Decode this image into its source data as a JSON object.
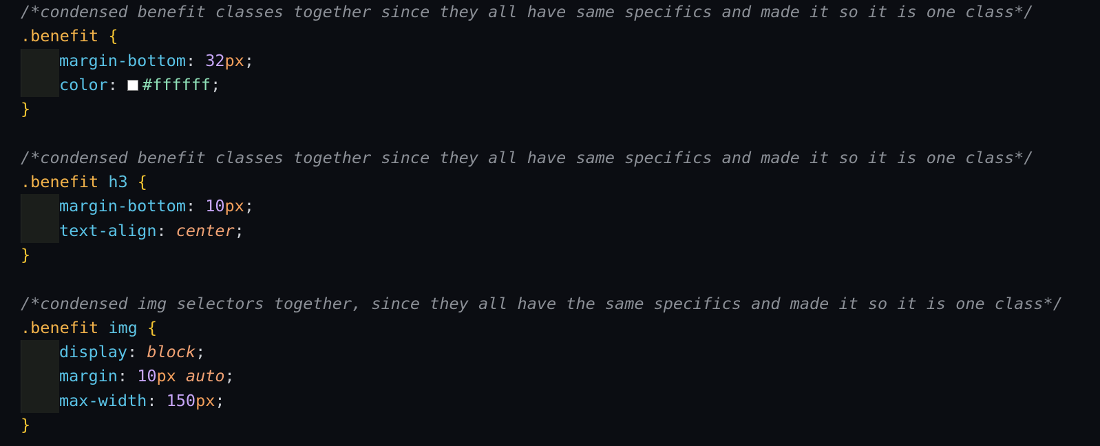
{
  "editor": {
    "blocks": [
      {
        "comment": "/*condensed benefit classes together since they all have same specifics and made it so it is one class*/",
        "selector": ".benefit",
        "element": "",
        "open": "{",
        "close": "}",
        "declarations": [
          {
            "prop": "margin-bottom",
            "num": "32",
            "unit": "px",
            "kw": "",
            "hex": "",
            "semi": ";"
          },
          {
            "prop": "color",
            "num": "",
            "unit": "",
            "kw": "",
            "hex": "#ffffff",
            "swatch": "#ffffff",
            "semi": ";"
          }
        ]
      },
      {
        "comment": "/*condensed benefit classes together since they all have same specifics and made it so it is one class*/",
        "selector": ".benefit",
        "element": " h3",
        "open": "{",
        "close": "}",
        "declarations": [
          {
            "prop": "margin-bottom",
            "num": "10",
            "unit": "px",
            "kw": "",
            "hex": "",
            "semi": ";"
          },
          {
            "prop": "text-align",
            "num": "",
            "unit": "",
            "kw": "center",
            "hex": "",
            "semi": ";"
          }
        ]
      },
      {
        "comment": "/*condensed img selectors together, since they all have the same specifics and made it so it is one class*/",
        "selector": ".benefit",
        "element": " img",
        "open": "{",
        "close": "}",
        "declarations": [
          {
            "prop": "display",
            "num": "",
            "unit": "",
            "kw": "block",
            "hex": "",
            "semi": ";"
          },
          {
            "prop": "margin",
            "num": "10",
            "unit": "px",
            "kw": " auto",
            "hex": "",
            "semi": ";"
          },
          {
            "prop": "max-width",
            "num": "150",
            "unit": "px",
            "kw": "",
            "hex": "",
            "semi": ";"
          }
        ]
      }
    ]
  }
}
